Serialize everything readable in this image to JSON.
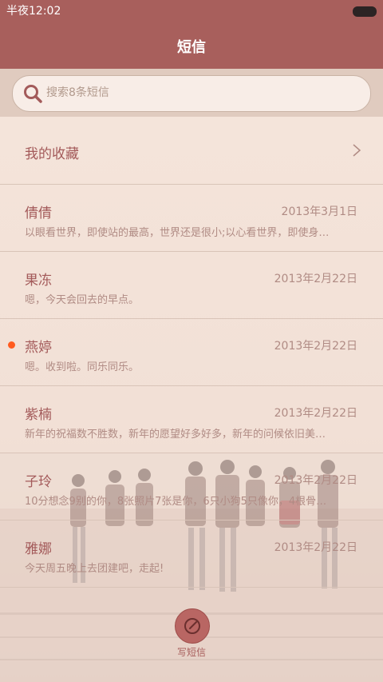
{
  "status_bar": {
    "time": "半夜12:02"
  },
  "header": {
    "title": "短信"
  },
  "search": {
    "placeholder": "搜索8条短信"
  },
  "favorites": {
    "label": "我的收藏"
  },
  "messages": [
    {
      "name": "倩倩",
      "date": "2013年3月1日",
      "preview": "以眼看世界，即使站的最高，世界还是很小;以心看世界，即使身…",
      "unread": false
    },
    {
      "name": "果冻",
      "date": "2013年2月22日",
      "preview": "嗯，今天会回去的早点。",
      "unread": false
    },
    {
      "name": "燕婷",
      "date": "2013年2月22日",
      "preview": "嗯。收到啦。同乐同乐。",
      "unread": true
    },
    {
      "name": "紫楠",
      "date": "2013年2月22日",
      "preview": "新年的祝福数不胜数，新年的愿望好多好多，新年的问候依旧美…",
      "unread": false
    },
    {
      "name": "子玲",
      "date": "2013年2月22日",
      "preview": "10分想念9别的你，8张照片7张是你，6只小狗5只像你，4根骨…",
      "unread": false
    },
    {
      "name": "雅娜",
      "date": "2013年2月22日",
      "preview": "今天周五晚上去团建吧，走起!",
      "unread": false
    }
  ],
  "compose": {
    "label": "写短信"
  },
  "colors": {
    "accent": "#a85f5c",
    "unread_dot": "#ff5b1f",
    "name_text": "#a35a5a",
    "meta_text": "#b08b84"
  }
}
